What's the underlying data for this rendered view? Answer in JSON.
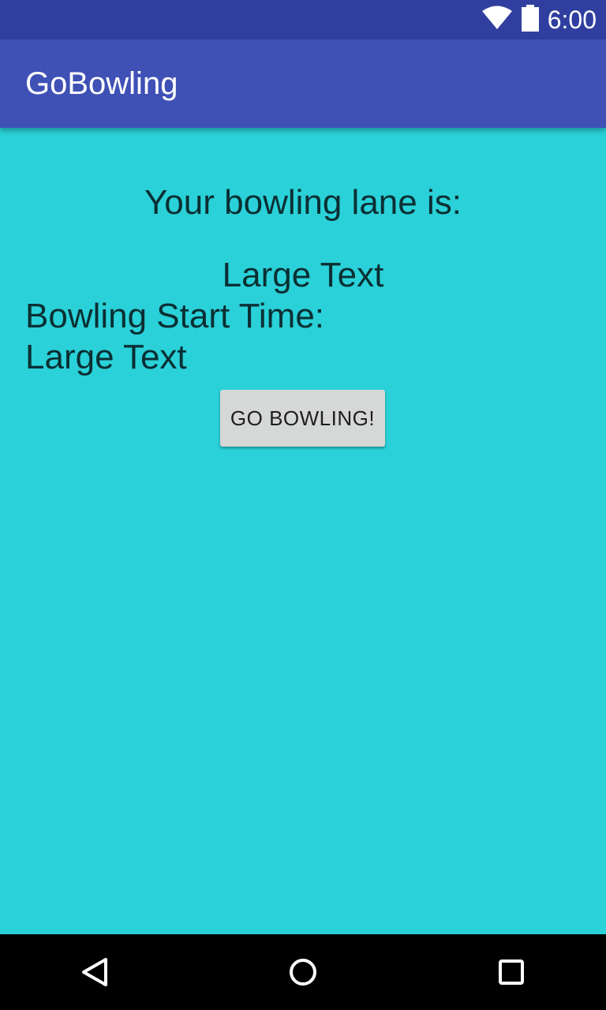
{
  "status_bar": {
    "time": "6:00",
    "icons": [
      "wifi-icon",
      "battery-icon"
    ]
  },
  "app_bar": {
    "title": "GoBowling"
  },
  "main": {
    "lane_heading": "Your bowling lane is:",
    "lane_value": "Large Text",
    "start_time_label": "Bowling Start Time:",
    "start_time_value": "Large Text",
    "go_button_label": "GO BOWLING!"
  },
  "nav_bar": {
    "icons": [
      "back-icon",
      "home-icon",
      "recents-icon"
    ]
  },
  "colors": {
    "status_bar": "#303F9F",
    "app_bar": "#3F51B5",
    "background": "#2AD1D8",
    "button": "#D6D7D7",
    "text": "#0B2F33"
  }
}
